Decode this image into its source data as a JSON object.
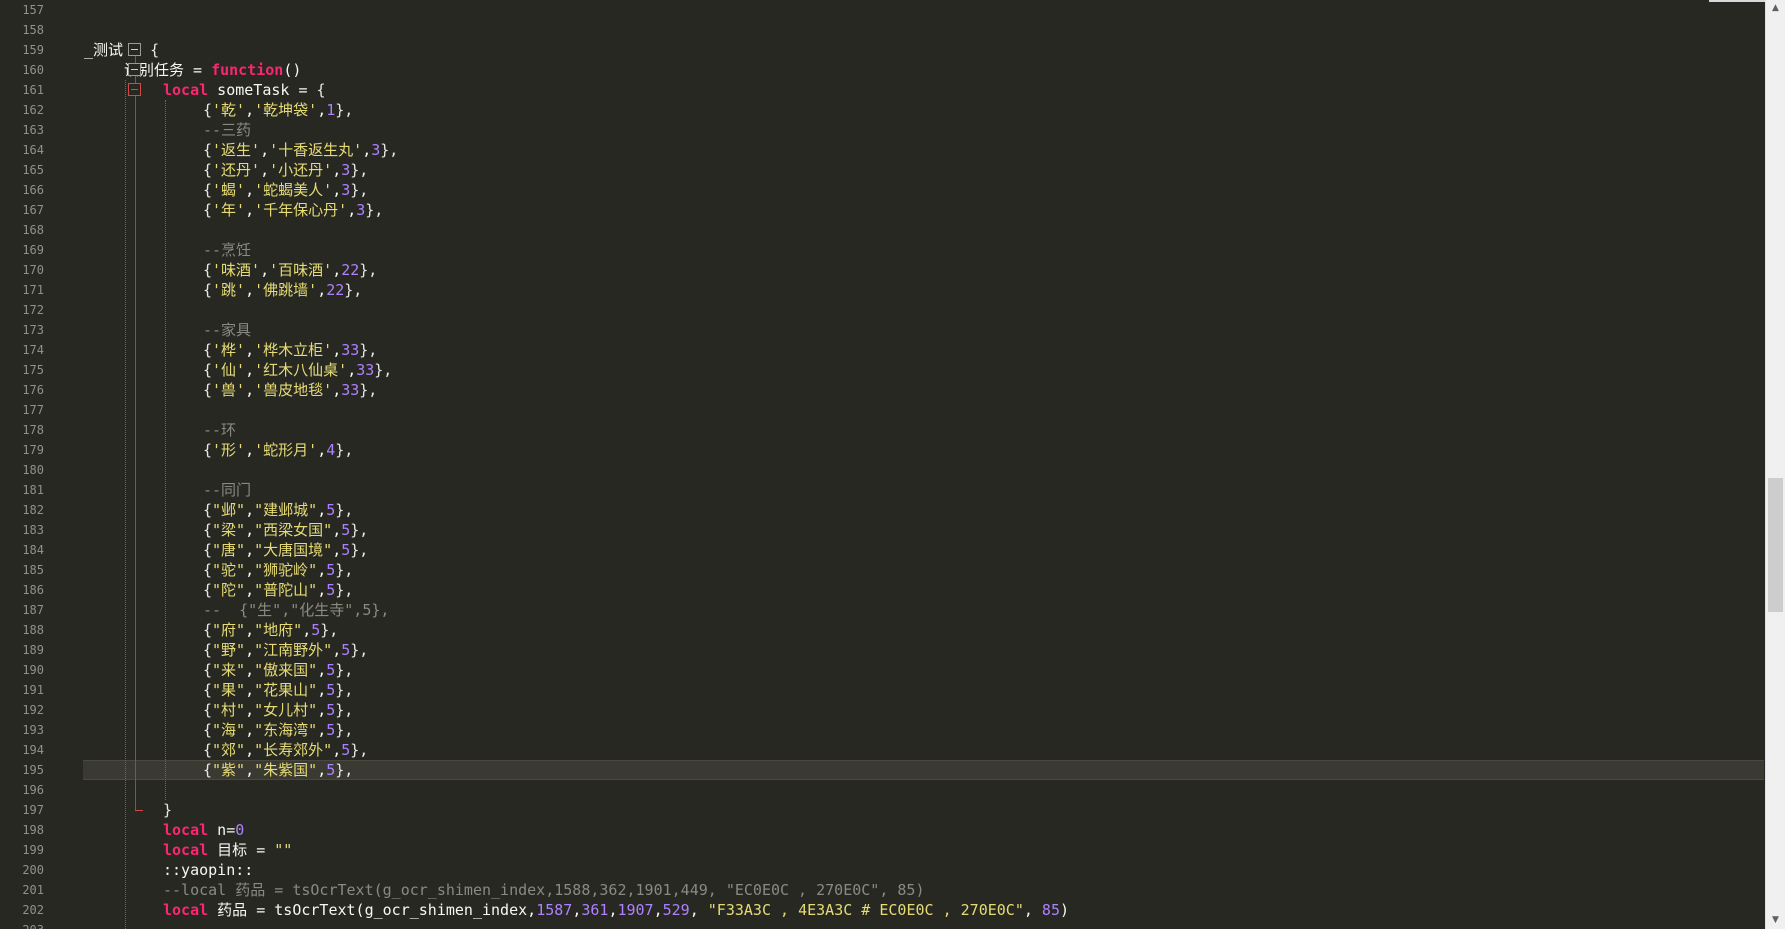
{
  "editor": {
    "highlight_color": "#3b3a32",
    "lines": [
      {
        "no": "157",
        "indent": 0,
        "tokens": []
      },
      {
        "no": "158",
        "indent": 0,
        "tokens": []
      },
      {
        "no": "159",
        "indent": 0,
        "tokens": [
          {
            "t": "_测试 ",
            "c": "text"
          },
          {
            "t": "= ",
            "c": "punc"
          },
          {
            "t": "{",
            "c": "brace"
          }
        ]
      },
      {
        "no": "160",
        "indent": 1,
        "tokens": [
          {
            "t": "识别任务 ",
            "c": "text"
          },
          {
            "t": "= ",
            "c": "punc"
          },
          {
            "t": "function",
            "c": "kw"
          },
          {
            "t": "()",
            "c": "punc"
          }
        ]
      },
      {
        "no": "161",
        "indent": 2,
        "tokens": [
          {
            "t": "local",
            "c": "kw"
          },
          {
            "t": " someTask ",
            "c": "text"
          },
          {
            "t": "= ",
            "c": "punc"
          },
          {
            "t": "{",
            "c": "brace"
          }
        ]
      },
      {
        "no": "162",
        "indent": 3,
        "tokens": [
          {
            "t": "{",
            "c": "brace"
          },
          {
            "t": "'乾'",
            "c": "str"
          },
          {
            "t": ",",
            "c": "punc"
          },
          {
            "t": "'乾坤袋'",
            "c": "str"
          },
          {
            "t": ",",
            "c": "punc"
          },
          {
            "t": "1",
            "c": "num"
          },
          {
            "t": "},",
            "c": "brace"
          }
        ]
      },
      {
        "no": "163",
        "indent": 3,
        "tokens": [
          {
            "t": "--三药",
            "c": "cmt"
          }
        ]
      },
      {
        "no": "164",
        "indent": 3,
        "tokens": [
          {
            "t": "{",
            "c": "brace"
          },
          {
            "t": "'返生'",
            "c": "str"
          },
          {
            "t": ",",
            "c": "punc"
          },
          {
            "t": "'十香返生丸'",
            "c": "str"
          },
          {
            "t": ",",
            "c": "punc"
          },
          {
            "t": "3",
            "c": "num"
          },
          {
            "t": "},",
            "c": "brace"
          }
        ]
      },
      {
        "no": "165",
        "indent": 3,
        "tokens": [
          {
            "t": "{",
            "c": "brace"
          },
          {
            "t": "'还丹'",
            "c": "str"
          },
          {
            "t": ",",
            "c": "punc"
          },
          {
            "t": "'小还丹'",
            "c": "str"
          },
          {
            "t": ",",
            "c": "punc"
          },
          {
            "t": "3",
            "c": "num"
          },
          {
            "t": "},",
            "c": "brace"
          }
        ]
      },
      {
        "no": "166",
        "indent": 3,
        "tokens": [
          {
            "t": "{",
            "c": "brace"
          },
          {
            "t": "'蝎'",
            "c": "str"
          },
          {
            "t": ",",
            "c": "punc"
          },
          {
            "t": "'蛇蝎美人'",
            "c": "str"
          },
          {
            "t": ",",
            "c": "punc"
          },
          {
            "t": "3",
            "c": "num"
          },
          {
            "t": "},",
            "c": "brace"
          }
        ]
      },
      {
        "no": "167",
        "indent": 3,
        "tokens": [
          {
            "t": "{",
            "c": "brace"
          },
          {
            "t": "'年'",
            "c": "str"
          },
          {
            "t": ",",
            "c": "punc"
          },
          {
            "t": "'千年保心丹'",
            "c": "str"
          },
          {
            "t": ",",
            "c": "punc"
          },
          {
            "t": "3",
            "c": "num"
          },
          {
            "t": "},",
            "c": "brace"
          }
        ]
      },
      {
        "no": "168",
        "indent": 0,
        "tokens": []
      },
      {
        "no": "169",
        "indent": 3,
        "tokens": [
          {
            "t": "--烹饪",
            "c": "cmt"
          }
        ]
      },
      {
        "no": "170",
        "indent": 3,
        "tokens": [
          {
            "t": "{",
            "c": "brace"
          },
          {
            "t": "'味酒'",
            "c": "str"
          },
          {
            "t": ",",
            "c": "punc"
          },
          {
            "t": "'百味酒'",
            "c": "str"
          },
          {
            "t": ",",
            "c": "punc"
          },
          {
            "t": "22",
            "c": "num"
          },
          {
            "t": "},",
            "c": "brace"
          }
        ]
      },
      {
        "no": "171",
        "indent": 3,
        "tokens": [
          {
            "t": "{",
            "c": "brace"
          },
          {
            "t": "'跳'",
            "c": "str"
          },
          {
            "t": ",",
            "c": "punc"
          },
          {
            "t": "'佛跳墙'",
            "c": "str"
          },
          {
            "t": ",",
            "c": "punc"
          },
          {
            "t": "22",
            "c": "num"
          },
          {
            "t": "},",
            "c": "brace"
          }
        ]
      },
      {
        "no": "172",
        "indent": 0,
        "tokens": []
      },
      {
        "no": "173",
        "indent": 3,
        "tokens": [
          {
            "t": "--家具",
            "c": "cmt"
          }
        ]
      },
      {
        "no": "174",
        "indent": 3,
        "tokens": [
          {
            "t": "{",
            "c": "brace"
          },
          {
            "t": "'桦'",
            "c": "str"
          },
          {
            "t": ",",
            "c": "punc"
          },
          {
            "t": "'桦木立柜'",
            "c": "str"
          },
          {
            "t": ",",
            "c": "punc"
          },
          {
            "t": "33",
            "c": "num"
          },
          {
            "t": "},",
            "c": "brace"
          }
        ]
      },
      {
        "no": "175",
        "indent": 3,
        "tokens": [
          {
            "t": "{",
            "c": "brace"
          },
          {
            "t": "'仙'",
            "c": "str"
          },
          {
            "t": ",",
            "c": "punc"
          },
          {
            "t": "'红木八仙桌'",
            "c": "str"
          },
          {
            "t": ",",
            "c": "punc"
          },
          {
            "t": "33",
            "c": "num"
          },
          {
            "t": "},",
            "c": "brace"
          }
        ]
      },
      {
        "no": "176",
        "indent": 3,
        "tokens": [
          {
            "t": "{",
            "c": "brace"
          },
          {
            "t": "'兽'",
            "c": "str"
          },
          {
            "t": ",",
            "c": "punc"
          },
          {
            "t": "'兽皮地毯'",
            "c": "str"
          },
          {
            "t": ",",
            "c": "punc"
          },
          {
            "t": "33",
            "c": "num"
          },
          {
            "t": "},",
            "c": "brace"
          }
        ]
      },
      {
        "no": "177",
        "indent": 0,
        "tokens": []
      },
      {
        "no": "178",
        "indent": 3,
        "tokens": [
          {
            "t": "--环",
            "c": "cmt"
          }
        ]
      },
      {
        "no": "179",
        "indent": 3,
        "tokens": [
          {
            "t": "{",
            "c": "brace"
          },
          {
            "t": "'形'",
            "c": "str"
          },
          {
            "t": ",",
            "c": "punc"
          },
          {
            "t": "'蛇形月'",
            "c": "str"
          },
          {
            "t": ",",
            "c": "punc"
          },
          {
            "t": "4",
            "c": "num"
          },
          {
            "t": "},",
            "c": "brace"
          }
        ]
      },
      {
        "no": "180",
        "indent": 0,
        "tokens": []
      },
      {
        "no": "181",
        "indent": 3,
        "tokens": [
          {
            "t": "--同门",
            "c": "cmt"
          }
        ]
      },
      {
        "no": "182",
        "indent": 3,
        "tokens": [
          {
            "t": "{",
            "c": "brace"
          },
          {
            "t": "\"邺\"",
            "c": "str"
          },
          {
            "t": ",",
            "c": "punc"
          },
          {
            "t": "\"建邺城\"",
            "c": "str"
          },
          {
            "t": ",",
            "c": "punc"
          },
          {
            "t": "5",
            "c": "num"
          },
          {
            "t": "},",
            "c": "brace"
          }
        ]
      },
      {
        "no": "183",
        "indent": 3,
        "tokens": [
          {
            "t": "{",
            "c": "brace"
          },
          {
            "t": "\"梁\"",
            "c": "str"
          },
          {
            "t": ",",
            "c": "punc"
          },
          {
            "t": "\"西梁女国\"",
            "c": "str"
          },
          {
            "t": ",",
            "c": "punc"
          },
          {
            "t": "5",
            "c": "num"
          },
          {
            "t": "},",
            "c": "brace"
          }
        ]
      },
      {
        "no": "184",
        "indent": 3,
        "tokens": [
          {
            "t": "{",
            "c": "brace"
          },
          {
            "t": "\"唐\"",
            "c": "str"
          },
          {
            "t": ",",
            "c": "punc"
          },
          {
            "t": "\"大唐国境\"",
            "c": "str"
          },
          {
            "t": ",",
            "c": "punc"
          },
          {
            "t": "5",
            "c": "num"
          },
          {
            "t": "},",
            "c": "brace"
          }
        ]
      },
      {
        "no": "185",
        "indent": 3,
        "tokens": [
          {
            "t": "{",
            "c": "brace"
          },
          {
            "t": "\"驼\"",
            "c": "str"
          },
          {
            "t": ",",
            "c": "punc"
          },
          {
            "t": "\"狮驼岭\"",
            "c": "str"
          },
          {
            "t": ",",
            "c": "punc"
          },
          {
            "t": "5",
            "c": "num"
          },
          {
            "t": "},",
            "c": "brace"
          }
        ]
      },
      {
        "no": "186",
        "indent": 3,
        "tokens": [
          {
            "t": "{",
            "c": "brace"
          },
          {
            "t": "\"陀\"",
            "c": "str"
          },
          {
            "t": ",",
            "c": "punc"
          },
          {
            "t": "\"普陀山\"",
            "c": "str"
          },
          {
            "t": ",",
            "c": "punc"
          },
          {
            "t": "5",
            "c": "num"
          },
          {
            "t": "},",
            "c": "brace"
          }
        ]
      },
      {
        "no": "187",
        "indent": 3,
        "tokens": [
          {
            "t": "--  {\"生\",\"化生寺\",5},",
            "c": "cmt"
          }
        ]
      },
      {
        "no": "188",
        "indent": 3,
        "tokens": [
          {
            "t": "{",
            "c": "brace"
          },
          {
            "t": "\"府\"",
            "c": "str"
          },
          {
            "t": ",",
            "c": "punc"
          },
          {
            "t": "\"地府\"",
            "c": "str"
          },
          {
            "t": ",",
            "c": "punc"
          },
          {
            "t": "5",
            "c": "num"
          },
          {
            "t": "},",
            "c": "brace"
          }
        ]
      },
      {
        "no": "189",
        "indent": 3,
        "tokens": [
          {
            "t": "{",
            "c": "brace"
          },
          {
            "t": "\"野\"",
            "c": "str"
          },
          {
            "t": ",",
            "c": "punc"
          },
          {
            "t": "\"江南野外\"",
            "c": "str"
          },
          {
            "t": ",",
            "c": "punc"
          },
          {
            "t": "5",
            "c": "num"
          },
          {
            "t": "},",
            "c": "brace"
          }
        ]
      },
      {
        "no": "190",
        "indent": 3,
        "tokens": [
          {
            "t": "{",
            "c": "brace"
          },
          {
            "t": "\"来\"",
            "c": "str"
          },
          {
            "t": ",",
            "c": "punc"
          },
          {
            "t": "\"傲来国\"",
            "c": "str"
          },
          {
            "t": ",",
            "c": "punc"
          },
          {
            "t": "5",
            "c": "num"
          },
          {
            "t": "},",
            "c": "brace"
          }
        ]
      },
      {
        "no": "191",
        "indent": 3,
        "tokens": [
          {
            "t": "{",
            "c": "brace"
          },
          {
            "t": "\"果\"",
            "c": "str"
          },
          {
            "t": ",",
            "c": "punc"
          },
          {
            "t": "\"花果山\"",
            "c": "str"
          },
          {
            "t": ",",
            "c": "punc"
          },
          {
            "t": "5",
            "c": "num"
          },
          {
            "t": "},",
            "c": "brace"
          }
        ]
      },
      {
        "no": "192",
        "indent": 3,
        "tokens": [
          {
            "t": "{",
            "c": "brace"
          },
          {
            "t": "\"村\"",
            "c": "str"
          },
          {
            "t": ",",
            "c": "punc"
          },
          {
            "t": "\"女儿村\"",
            "c": "str"
          },
          {
            "t": ",",
            "c": "punc"
          },
          {
            "t": "5",
            "c": "num"
          },
          {
            "t": "},",
            "c": "brace"
          }
        ]
      },
      {
        "no": "193",
        "indent": 3,
        "tokens": [
          {
            "t": "{",
            "c": "brace"
          },
          {
            "t": "\"海\"",
            "c": "str"
          },
          {
            "t": ",",
            "c": "punc"
          },
          {
            "t": "\"东海湾\"",
            "c": "str"
          },
          {
            "t": ",",
            "c": "punc"
          },
          {
            "t": "5",
            "c": "num"
          },
          {
            "t": "},",
            "c": "brace"
          }
        ]
      },
      {
        "no": "194",
        "indent": 3,
        "tokens": [
          {
            "t": "{",
            "c": "brace"
          },
          {
            "t": "\"郊\"",
            "c": "str"
          },
          {
            "t": ",",
            "c": "punc"
          },
          {
            "t": "\"长寿郊外\"",
            "c": "str"
          },
          {
            "t": ",",
            "c": "punc"
          },
          {
            "t": "5",
            "c": "num"
          },
          {
            "t": "},",
            "c": "brace"
          }
        ]
      },
      {
        "no": "195",
        "indent": 3,
        "current": true,
        "tokens": [
          {
            "t": "{",
            "c": "brace"
          },
          {
            "t": "\"紫\"",
            "c": "str"
          },
          {
            "t": ",",
            "c": "punc"
          },
          {
            "t": "\"朱紫国\"",
            "c": "str"
          },
          {
            "t": ",",
            "c": "punc"
          },
          {
            "t": "5",
            "c": "num"
          },
          {
            "t": "},",
            "c": "brace"
          }
        ]
      },
      {
        "no": "196",
        "indent": 0,
        "tokens": []
      },
      {
        "no": "197",
        "indent": 2,
        "tokens": [
          {
            "t": "}",
            "c": "brace"
          }
        ]
      },
      {
        "no": "198",
        "indent": 2,
        "tokens": [
          {
            "t": "local",
            "c": "kw"
          },
          {
            "t": " n",
            "c": "text"
          },
          {
            "t": "=",
            "c": "punc"
          },
          {
            "t": "0",
            "c": "num"
          }
        ]
      },
      {
        "no": "199",
        "indent": 2,
        "tokens": [
          {
            "t": "local",
            "c": "kw"
          },
          {
            "t": " 目标 ",
            "c": "text"
          },
          {
            "t": "= ",
            "c": "punc"
          },
          {
            "t": "\"\"",
            "c": "str"
          }
        ]
      },
      {
        "no": "200",
        "indent": 2,
        "tokens": [
          {
            "t": "::yaopin::",
            "c": "text"
          }
        ]
      },
      {
        "no": "201",
        "indent": 2,
        "tokens": [
          {
            "t": "--local 药品 = tsOcrText(g_ocr_shimen_index,1588,362,1901,449, \"EC0E0C , 270E0C\", 85)",
            "c": "cmt"
          }
        ]
      },
      {
        "no": "202",
        "indent": 2,
        "tokens": [
          {
            "t": "local",
            "c": "kw"
          },
          {
            "t": " 药品 ",
            "c": "text"
          },
          {
            "t": "= ",
            "c": "punc"
          },
          {
            "t": "tsOcrText(g_ocr_shimen_index,",
            "c": "text"
          },
          {
            "t": "1587",
            "c": "num"
          },
          {
            "t": ",",
            "c": "punc"
          },
          {
            "t": "361",
            "c": "num"
          },
          {
            "t": ",",
            "c": "punc"
          },
          {
            "t": "1907",
            "c": "num"
          },
          {
            "t": ",",
            "c": "punc"
          },
          {
            "t": "529",
            "c": "num"
          },
          {
            "t": ", ",
            "c": "punc"
          },
          {
            "t": "\"F33A3C , 4E3A3C # EC0E0C , 270E0C\"",
            "c": "str"
          },
          {
            "t": ", ",
            "c": "punc"
          },
          {
            "t": "85",
            "c": "num"
          },
          {
            "t": ")",
            "c": "punc"
          }
        ]
      },
      {
        "no": "203",
        "indent": 0,
        "tokens": []
      }
    ]
  },
  "scrollbar": {
    "up_icon": "▲",
    "down_icon": "▼"
  }
}
